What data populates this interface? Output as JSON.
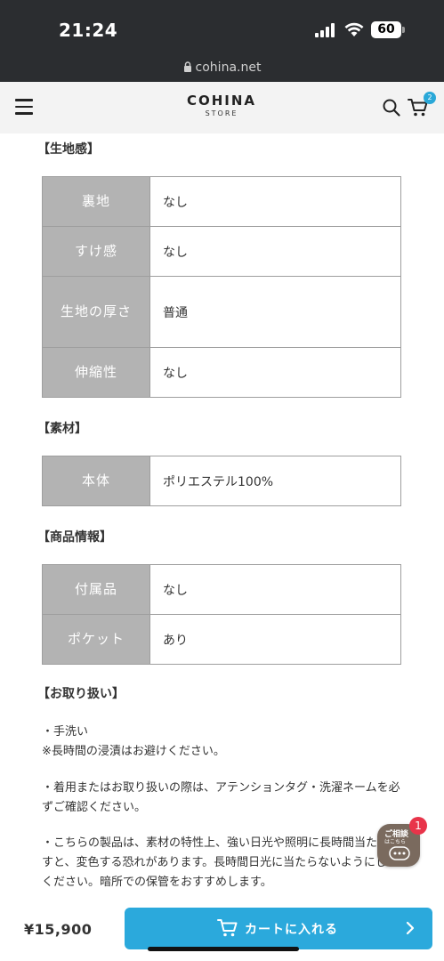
{
  "status_bar": {
    "time": "21:24",
    "battery": "60"
  },
  "url_bar": {
    "domain": "cohina.net"
  },
  "header": {
    "brand": "COHINA",
    "brand_sub": "STORE",
    "cart_count": "2"
  },
  "sections": {
    "fabric": {
      "title": "【生地感】",
      "rows": [
        {
          "label": "裏地",
          "value": "なし"
        },
        {
          "label": "すけ感",
          "value": "なし"
        },
        {
          "label": "生地の厚さ",
          "value": "普通"
        },
        {
          "label": "伸縮性",
          "value": "なし"
        }
      ]
    },
    "material": {
      "title": "【素材】",
      "rows": [
        {
          "label": "本体",
          "value": "ポリエステル100%"
        }
      ]
    },
    "info": {
      "title": "【商品情報】",
      "rows": [
        {
          "label": "付属品",
          "value": "なし"
        },
        {
          "label": "ポケット",
          "value": "あり"
        }
      ]
    },
    "care": {
      "title": "【お取り扱い】",
      "paragraphs": [
        "・手洗い",
        "※長時間の浸漬はお避けください。",
        "・着用またはお取り扱いの際は、アテンションタグ・洗濯ネームを必ずご確認ください。",
        "・こちらの製品は、素材の特性上、強い日光や照明に長時間当たりますと、変色する恐れがあります。長時間日光に当たらないようにしてください。暗所での保管をおすすめします。"
      ]
    }
  },
  "chat_widget": {
    "line1": "ご相談",
    "line2": "はこちら",
    "badge": "1"
  },
  "bottom_bar": {
    "price": "¥15,900",
    "cart_button": "カートに入れる"
  },
  "colors": {
    "accent": "#2ba9dc",
    "table_header": "#b3b3b3",
    "badge_red": "#e8344a"
  }
}
